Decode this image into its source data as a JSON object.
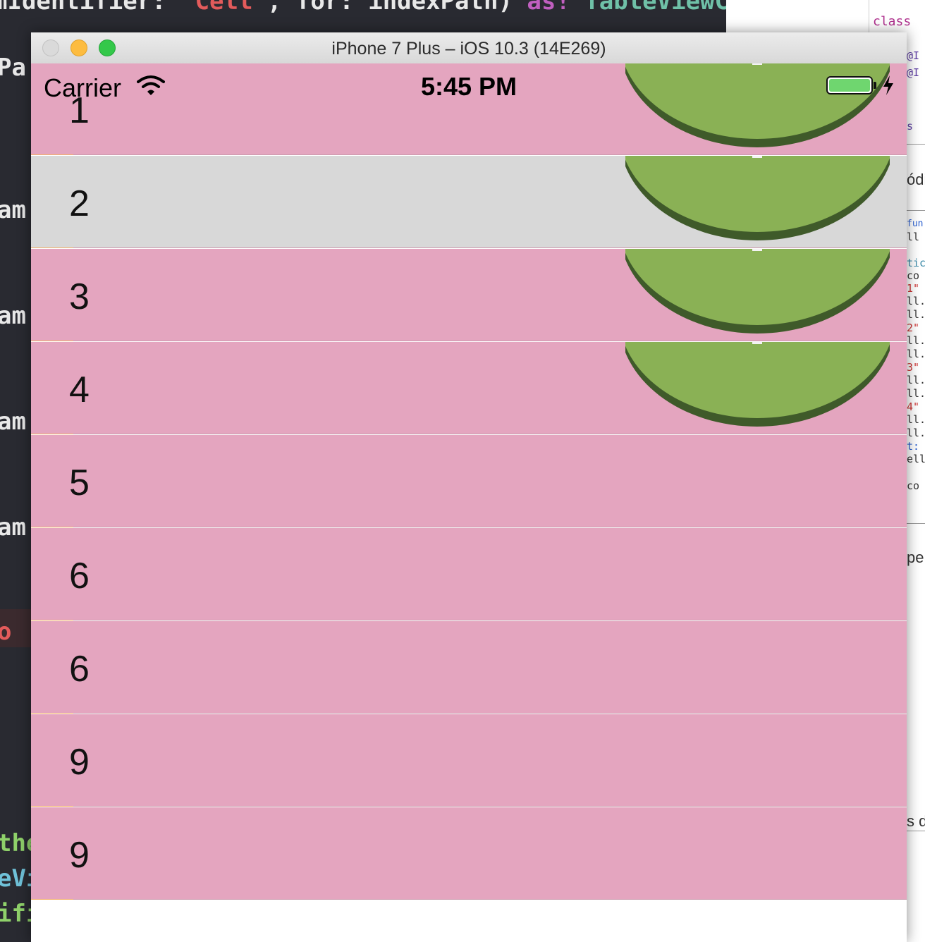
{
  "background_editor": {
    "top_line": {
      "a": "mIdentifier: ",
      "b": "\"Cell\"",
      "c": ", for: indexPath) ",
      "d": "as!",
      "e": " TableViewCellNuevo"
    },
    "left_fragments": [
      "Pa",
      "am",
      "am",
      "am",
      "am",
      "o :",
      "the",
      "eVi",
      "ifie"
    ],
    "right_keyword": "class",
    "right_fragments": [
      "@I",
      "@I",
      "s",
      "ódi",
      "fun",
      "ll",
      "tic",
      "co",
      "1\"",
      "ll.",
      "ll.",
      "2\"",
      "ll.",
      "ll.",
      "3\"",
      "ll.",
      "ll.",
      "4\"",
      "ll.",
      "ll.",
      "t:",
      "ell",
      "co",
      "pe",
      "s d"
    ]
  },
  "simulator": {
    "window_title": "iPhone 7 Plus – iOS 10.3 (14E269)",
    "status_bar": {
      "carrier": "Carrier",
      "time": "5:45 PM",
      "battery_level": 1.0,
      "charging": true
    },
    "rows": [
      {
        "label": "1",
        "selected": false,
        "has_image": true
      },
      {
        "label": "2",
        "selected": true,
        "has_image": true
      },
      {
        "label": "3",
        "selected": false,
        "has_image": true
      },
      {
        "label": "4",
        "selected": false,
        "has_image": true
      },
      {
        "label": "5",
        "selected": false,
        "has_image": false
      },
      {
        "label": "6",
        "selected": false,
        "has_image": false
      },
      {
        "label": "6",
        "selected": false,
        "has_image": false
      },
      {
        "label": "9",
        "selected": false,
        "has_image": false
      },
      {
        "label": "9",
        "selected": false,
        "has_image": false
      }
    ]
  },
  "colors": {
    "row_background": "#e4a5bf",
    "row_selected": "#d8d8d8",
    "image_green": "#8ab155",
    "image_rim": "#3f5a2a",
    "battery_green": "#6fd66f"
  }
}
